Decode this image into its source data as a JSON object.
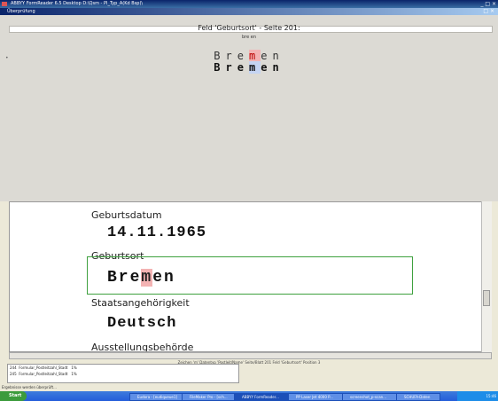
{
  "app_title": "ABBYY FormReader 6.5 Desktop D:\\Qsm - PI_Typ_A(Kd Bsp)\\",
  "dialog_title": "Überprüfung",
  "window_buttons": "_ □ ×",
  "dialog_buttons": "□ ×",
  "field_header": "Feld 'Geburtsort' - Seite 201:",
  "search_word": "bre  en",
  "token_line_top": [
    "B",
    "r",
    "e",
    "m",
    "e",
    "n"
  ],
  "token_line_bottom": [
    "B",
    "r",
    "e",
    "m",
    "e",
    "n"
  ],
  "document": {
    "fields": [
      {
        "label": "Geburtsdatum",
        "value": "14.11.1965"
      },
      {
        "label": "Geburtsort",
        "value_pre": "Bre",
        "value_hl": "m",
        "value_post": "en"
      },
      {
        "label": "Staatsangehörigkeit",
        "value": "Deutsch"
      },
      {
        "label": "Ausstellungsbehörde"
      }
    ]
  },
  "status_text": "Zeichen 'm'  Datentyp 'Postleit/Name'  Seite/Blatt 201  Feld 'Geburtsort'  Position 3",
  "list_rows": [
    {
      "num": "244",
      "name": "Formular_Postleitzahl_Stadt",
      "pct": "1%"
    },
    {
      "num": "245",
      "name": "Formular_Postleitzahl_Stadt",
      "pct": "1%"
    }
  ],
  "status_line": "Ergebnisse werden überprüft...",
  "taskbar": {
    "start": "Start",
    "tasks": [
      "Eudora - [eudiqueue1]",
      "FileMaker Pro - [sch...",
      "ABBYY FormReader...",
      "PP Laser Jet 4000 P...",
      "screenshot_p-scan...",
      "SCHUFA-Daten"
    ],
    "clock": "15:46"
  }
}
